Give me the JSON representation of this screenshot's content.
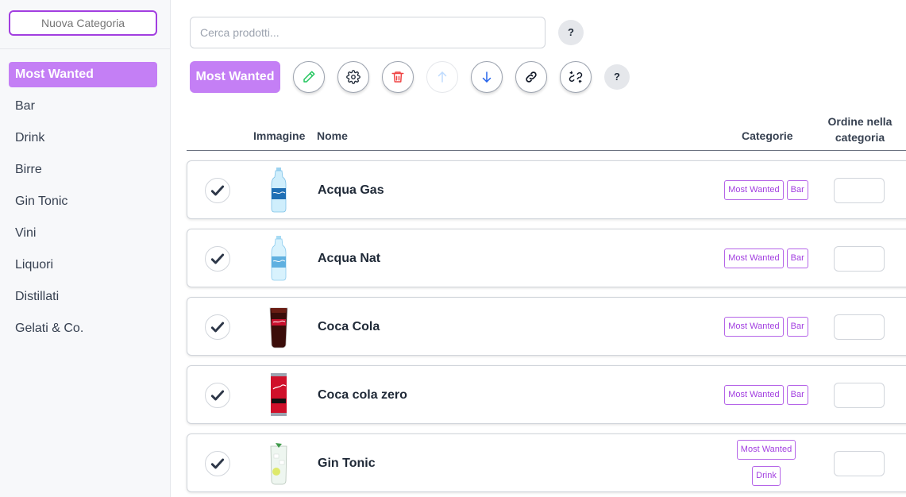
{
  "sidebar": {
    "new_category_placeholder": "Nuova Categoria",
    "items": [
      {
        "label": "Most Wanted",
        "active": true
      },
      {
        "label": "Bar"
      },
      {
        "label": "Drink"
      },
      {
        "label": "Birre"
      },
      {
        "label": "Gin Tonic"
      },
      {
        "label": "Vini"
      },
      {
        "label": "Liquori"
      },
      {
        "label": "Distillati"
      },
      {
        "label": "Gelati & Co."
      }
    ]
  },
  "search": {
    "placeholder": "Cerca prodotti..."
  },
  "help_label": "?",
  "toolbar": {
    "current_category": "Most Wanted",
    "tools": [
      {
        "icon": "pencil-icon",
        "color": "#22c55e"
      },
      {
        "icon": "gear-icon",
        "color": "#1f2937"
      },
      {
        "icon": "trash-icon",
        "color": "#ef4444"
      },
      {
        "icon": "arrow-up-icon",
        "color": "#bfdbfe"
      },
      {
        "icon": "arrow-down-icon",
        "color": "#2563eb"
      },
      {
        "icon": "link-icon",
        "color": "#111827"
      },
      {
        "icon": "unlink-icon",
        "color": "#111827"
      }
    ]
  },
  "table": {
    "headers": {
      "image": "Immagine",
      "name": "Nome",
      "categories": "Categorie",
      "order_line1": "Ordine nella",
      "order_line2": "categoria"
    },
    "rows": [
      {
        "name": "Acqua Gas",
        "checked": true,
        "image": "water-bottle",
        "categories": [
          "Most Wanted",
          "Bar"
        ]
      },
      {
        "name": "Acqua Nat",
        "checked": true,
        "image": "water-bottle",
        "categories": [
          "Most Wanted",
          "Bar"
        ]
      },
      {
        "name": "Coca Cola",
        "checked": true,
        "image": "cola-glass",
        "categories": [
          "Most Wanted",
          "Bar"
        ]
      },
      {
        "name": "Coca cola zero",
        "checked": true,
        "image": "cola-can",
        "categories": [
          "Most Wanted",
          "Bar"
        ]
      },
      {
        "name": "Gin Tonic",
        "checked": true,
        "image": "gin-tonic-glass",
        "categories": [
          "Most Wanted",
          "Drink"
        ]
      }
    ]
  },
  "colors": {
    "accent": "#c47ff5",
    "accent_border": "#a23ee0"
  }
}
